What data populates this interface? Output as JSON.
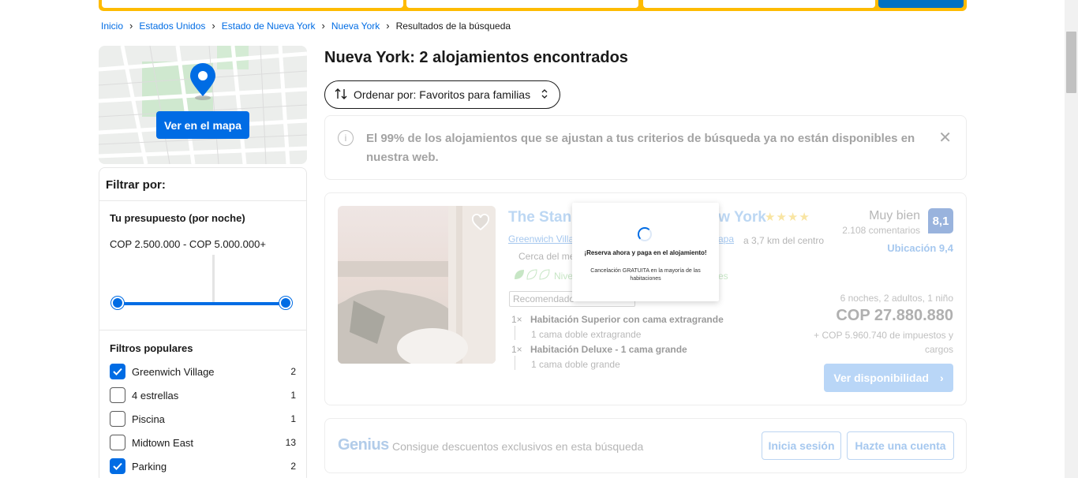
{
  "breadcrumb": {
    "items": [
      "Inicio",
      "Estados Unidos",
      "Estado de Nueva York",
      "Nueva York"
    ],
    "current": "Resultados de la búsqueda"
  },
  "map": {
    "button_label": "Ver en el mapa"
  },
  "filters": {
    "title": "Filtrar por:",
    "budget_title": "Tu presupuesto (por noche)",
    "budget_range": "COP 2.500.000 - COP 5.000.000+",
    "popular_title": "Filtros populares",
    "items": [
      {
        "label": "Greenwich Village",
        "count": "2",
        "checked": true
      },
      {
        "label": "4 estrellas",
        "count": "1",
        "checked": false
      },
      {
        "label": "Piscina",
        "count": "1",
        "checked": false
      },
      {
        "label": "Midtown East",
        "count": "13",
        "checked": false
      },
      {
        "label": "Parking",
        "count": "2",
        "checked": true
      }
    ]
  },
  "results": {
    "title": "Nueva York: 2 alojamientos encontrados",
    "sort_label": "Ordenar por: Favoritos para familias"
  },
  "notice": {
    "text": "El 99% de los alojamientos que se ajustan a tus criterios de búsqueda ya no están disponibles en nuestra web."
  },
  "hotel": {
    "name": "The Stan",
    "name_end": "w York",
    "stars": "★★★★",
    "location_link": "Greenwich Villa",
    "map_link": "apa",
    "distance": "a 3,7 km del centro",
    "near": "Cerca del me",
    "eco": "Nive",
    "eco_extra": "es",
    "recommended": "Recomendado",
    "rooms": [
      {
        "qty": "1×",
        "name": "Habitación Superior con cama extragrande",
        "bed": "1 cama doble extragrande"
      },
      {
        "qty": "1×",
        "name": "Habitación Deluxe - 1 cama grande",
        "bed": "1 cama doble grande"
      }
    ],
    "rating_word": "Muy bien",
    "rating_count": "2.108 comentarios",
    "score": "8,1",
    "location_score": "Ubicación 9,4",
    "stay": "6 noches, 2 adultos, 1 niño",
    "price": "COP 27.880.880",
    "taxes": "+ COP 5.960.740 de impuestos y cargos",
    "availability_button": "Ver disponibilidad"
  },
  "genius": {
    "logo": "Genius",
    "text": "Consigue descuentos exclusivos en esta búsqueda",
    "login_button": "Inicia sesión",
    "signup_button": "Hazte una cuenta"
  },
  "popup": {
    "title": "¡Reserva ahora y paga en el alojamiento!",
    "subtitle": "Cancelación GRATUITA en la mayoría de las habitaciones"
  },
  "colors": {
    "brand_blue": "#006ce4",
    "search_yellow": "#febb02",
    "score_blue": "#003b95"
  }
}
